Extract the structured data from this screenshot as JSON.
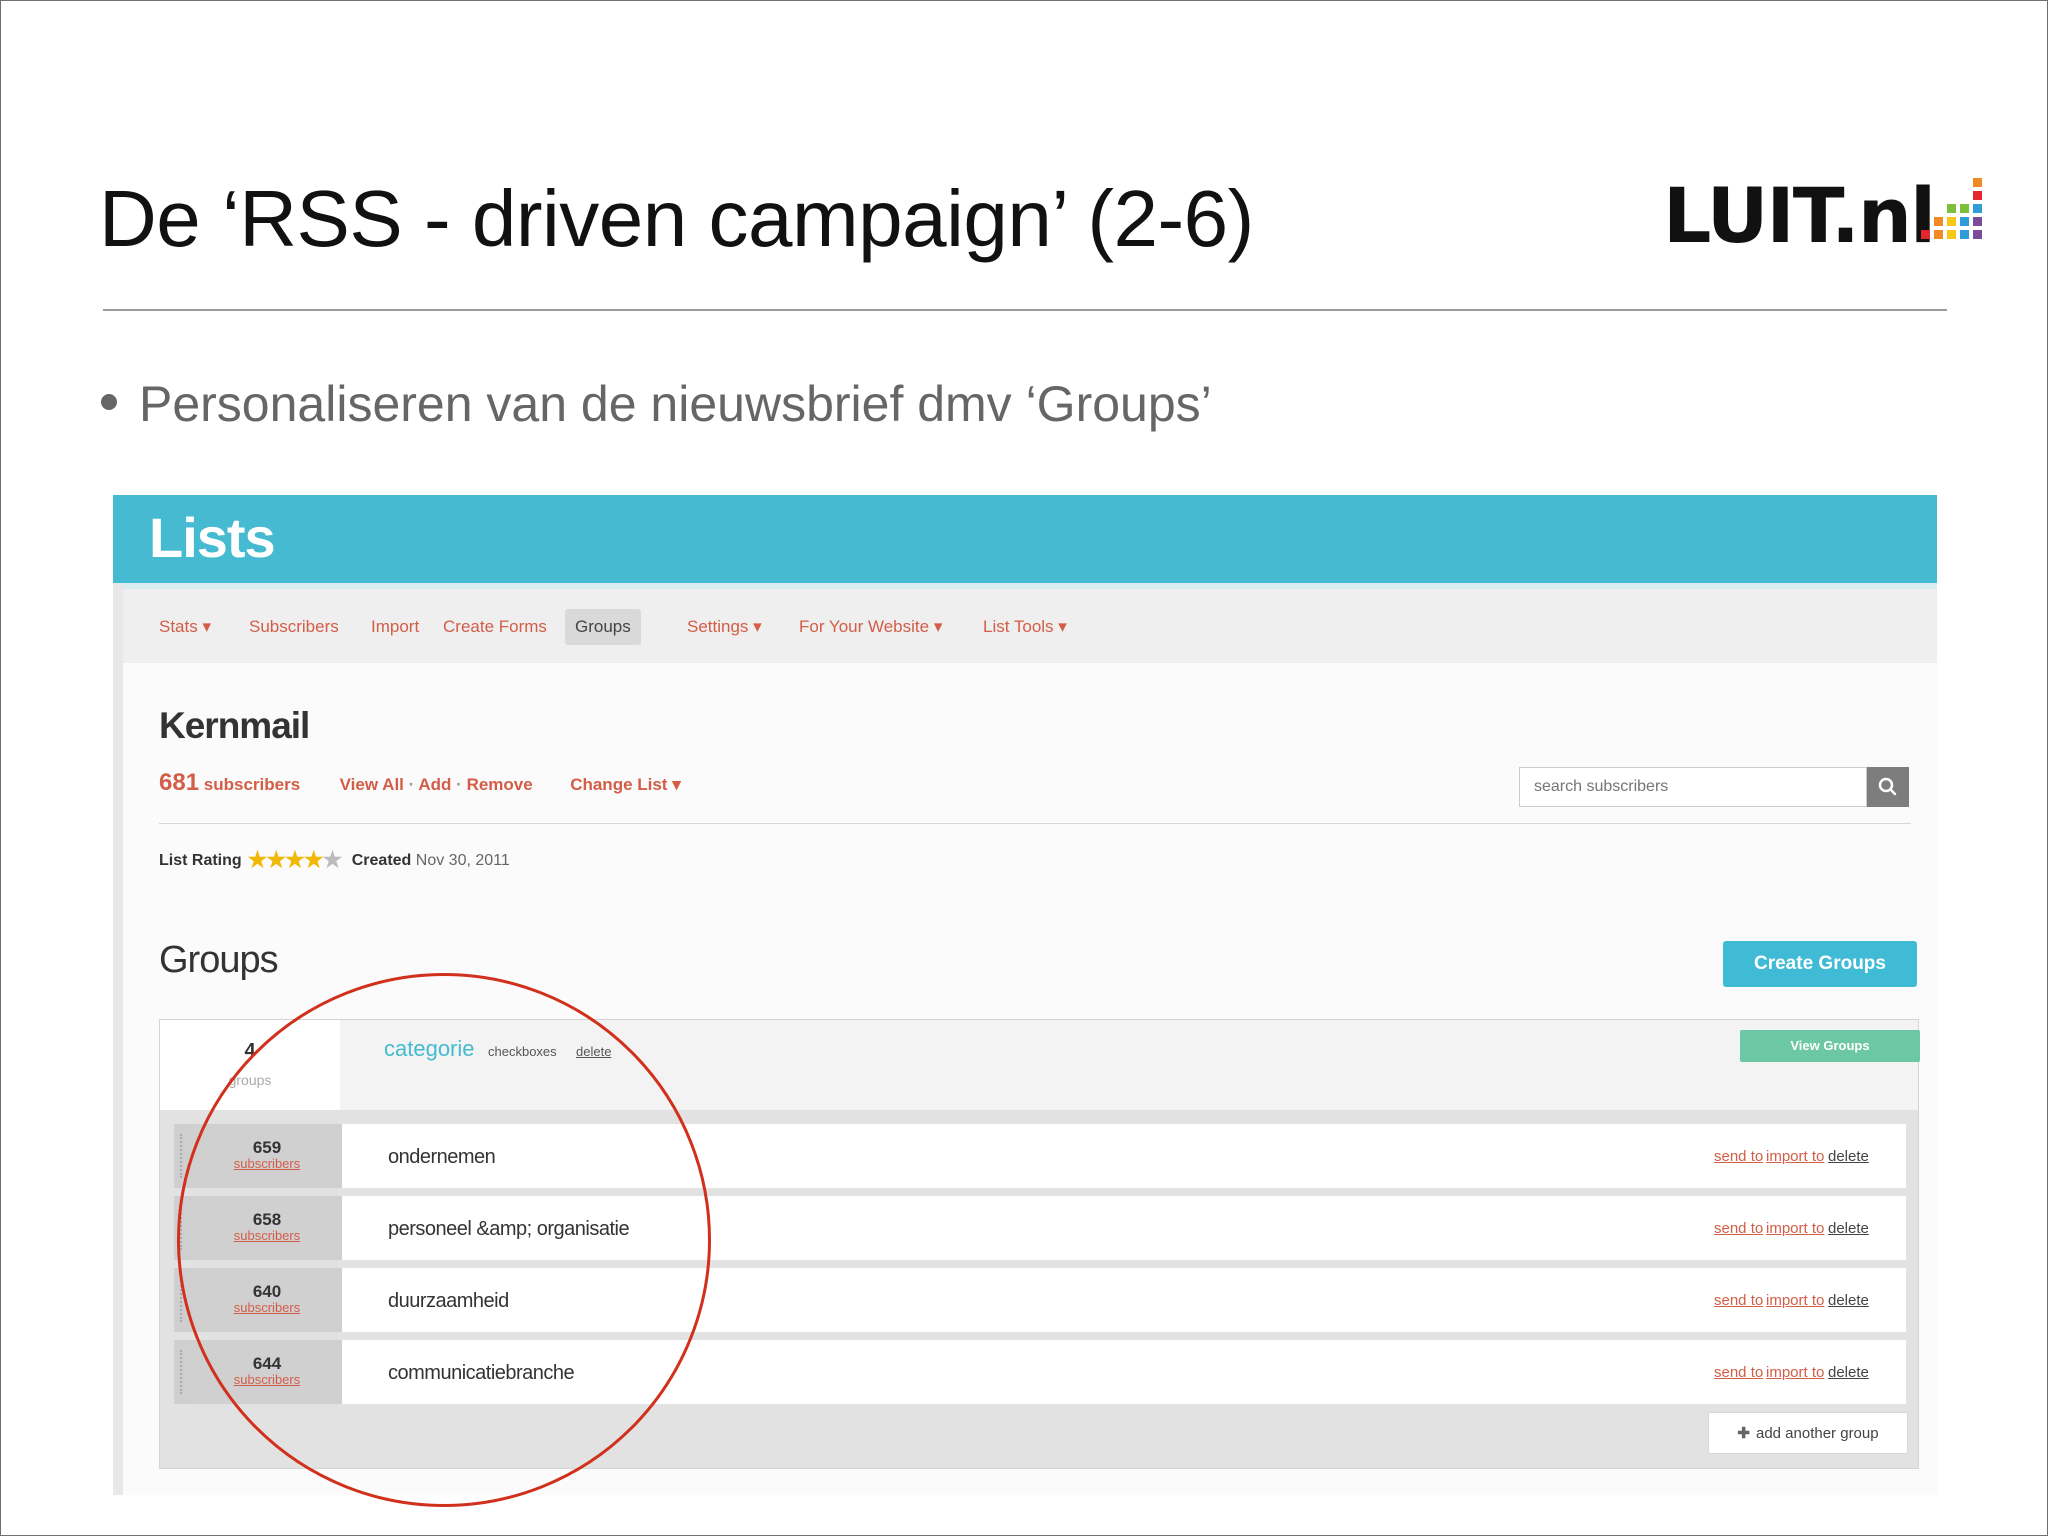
{
  "slide": {
    "title": "De ‘RSS - driven campaign’ (2-6)",
    "logo": "LUIT.nl",
    "bullet": "Personaliseren van de nieuwsbrief dmv ‘Groups’"
  },
  "app": {
    "banner_title": "Lists",
    "nav": [
      "Stats ▾",
      "Subscribers",
      "Import",
      "Create Forms",
      "Groups",
      "Settings ▾",
      "For Your Website ▾",
      "List Tools ▾"
    ],
    "list_name": "Kernmail",
    "subscriber_count": "681",
    "subscriber_label": "subscribers",
    "view_all": "View All",
    "add": "Add",
    "remove": "Remove",
    "change_list": "Change List ▾",
    "search_placeholder": "search subscribers",
    "list_rating_label": "List Rating",
    "rating_stars": 4,
    "created_label": "Created",
    "created_value": "Nov 30, 2011",
    "groups_title": "Groups",
    "create_groups_label": "Create Groups",
    "group": {
      "count": "4",
      "count_label": "groups",
      "name": "categorie",
      "type": "checkboxes",
      "delete": "delete",
      "view_groups": "View Groups"
    },
    "rows": [
      {
        "count": "659",
        "count_label": "subscribers",
        "name": "ondernemen"
      },
      {
        "count": "658",
        "count_label": "subscribers",
        "name": "personeel &amp; organisatie"
      },
      {
        "count": "640",
        "count_label": "subscribers",
        "name": "duurzaamheid"
      },
      {
        "count": "644",
        "count_label": "subscribers",
        "name": "communicatiebranche"
      }
    ],
    "row_actions": {
      "send_to": "send to",
      "import_to": "import to",
      "delete": "delete"
    },
    "add_group": "add another group"
  },
  "colors": {
    "banner": "#45bad0",
    "link_red": "#d35d47",
    "annotation_circle": "#d1301c",
    "view_groups_green": "#6cc7a4"
  }
}
